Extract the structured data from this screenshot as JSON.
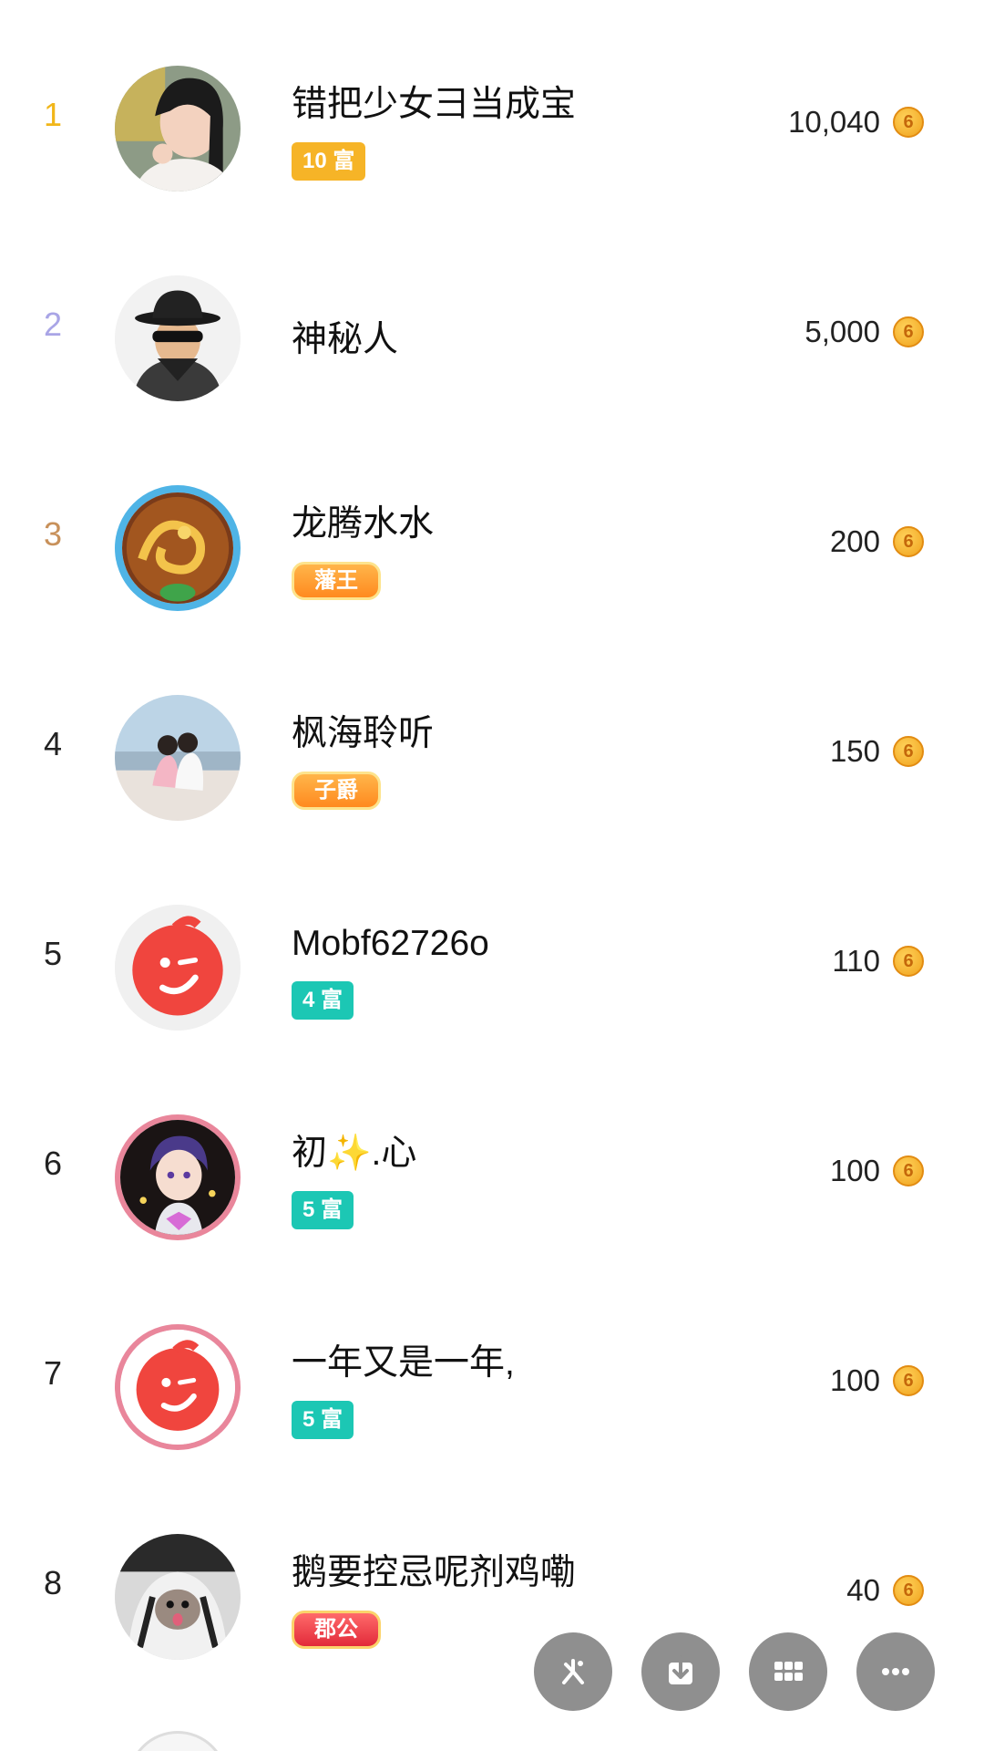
{
  "leaderboard": [
    {
      "rank": "1",
      "name": "错把少女彐当成宝",
      "badge": "10 富",
      "value": "10,040",
      "coin": "6",
      "avatar": "woman-portrait",
      "rank_color": "#f1b619"
    },
    {
      "rank": "2",
      "name": "神秘人",
      "badge": "",
      "value": "5,000",
      "coin": "6",
      "avatar": "mystery-man",
      "rank_color": "#a9a5e6"
    },
    {
      "rank": "3",
      "name": "龙腾水水",
      "badge": "藩王",
      "value": "200",
      "coin": "6",
      "avatar": "golden-dragon",
      "rank_color": "#c8915b"
    },
    {
      "rank": "4",
      "name": "枫海聆听",
      "badge": "子爵",
      "value": "150",
      "coin": "6",
      "avatar": "couple-beach",
      "rank_color": "#222222"
    },
    {
      "rank": "5",
      "name": "Mobf62726o",
      "badge": "4 富",
      "value": "110",
      "coin": "6",
      "avatar": "default-red-face",
      "rank_color": "#222222"
    },
    {
      "rank": "6",
      "name": "初✨.心",
      "badge": "5 富",
      "value": "100",
      "coin": "6",
      "avatar": "anime-boy",
      "rank_color": "#222222"
    },
    {
      "rank": "7",
      "name": "一年又是一年,",
      "badge": "5 富",
      "value": "100",
      "coin": "6",
      "avatar": "default-red-face",
      "rank_color": "#222222"
    },
    {
      "rank": "8",
      "name": "鹅要控忌呢剂鸡嘞",
      "badge": "郡公",
      "value": "40",
      "coin": "6",
      "avatar": "cat-hoodie",
      "rank_color": "#222222"
    }
  ],
  "fab_icons": [
    "asterisk-share-icon",
    "download-icon",
    "grid-icon",
    "more-icon"
  ],
  "colors": {
    "fab_bg": "#8f8f8f",
    "wealth_teal": "#1cc7b4",
    "wealth_orange": "#f6b427"
  }
}
